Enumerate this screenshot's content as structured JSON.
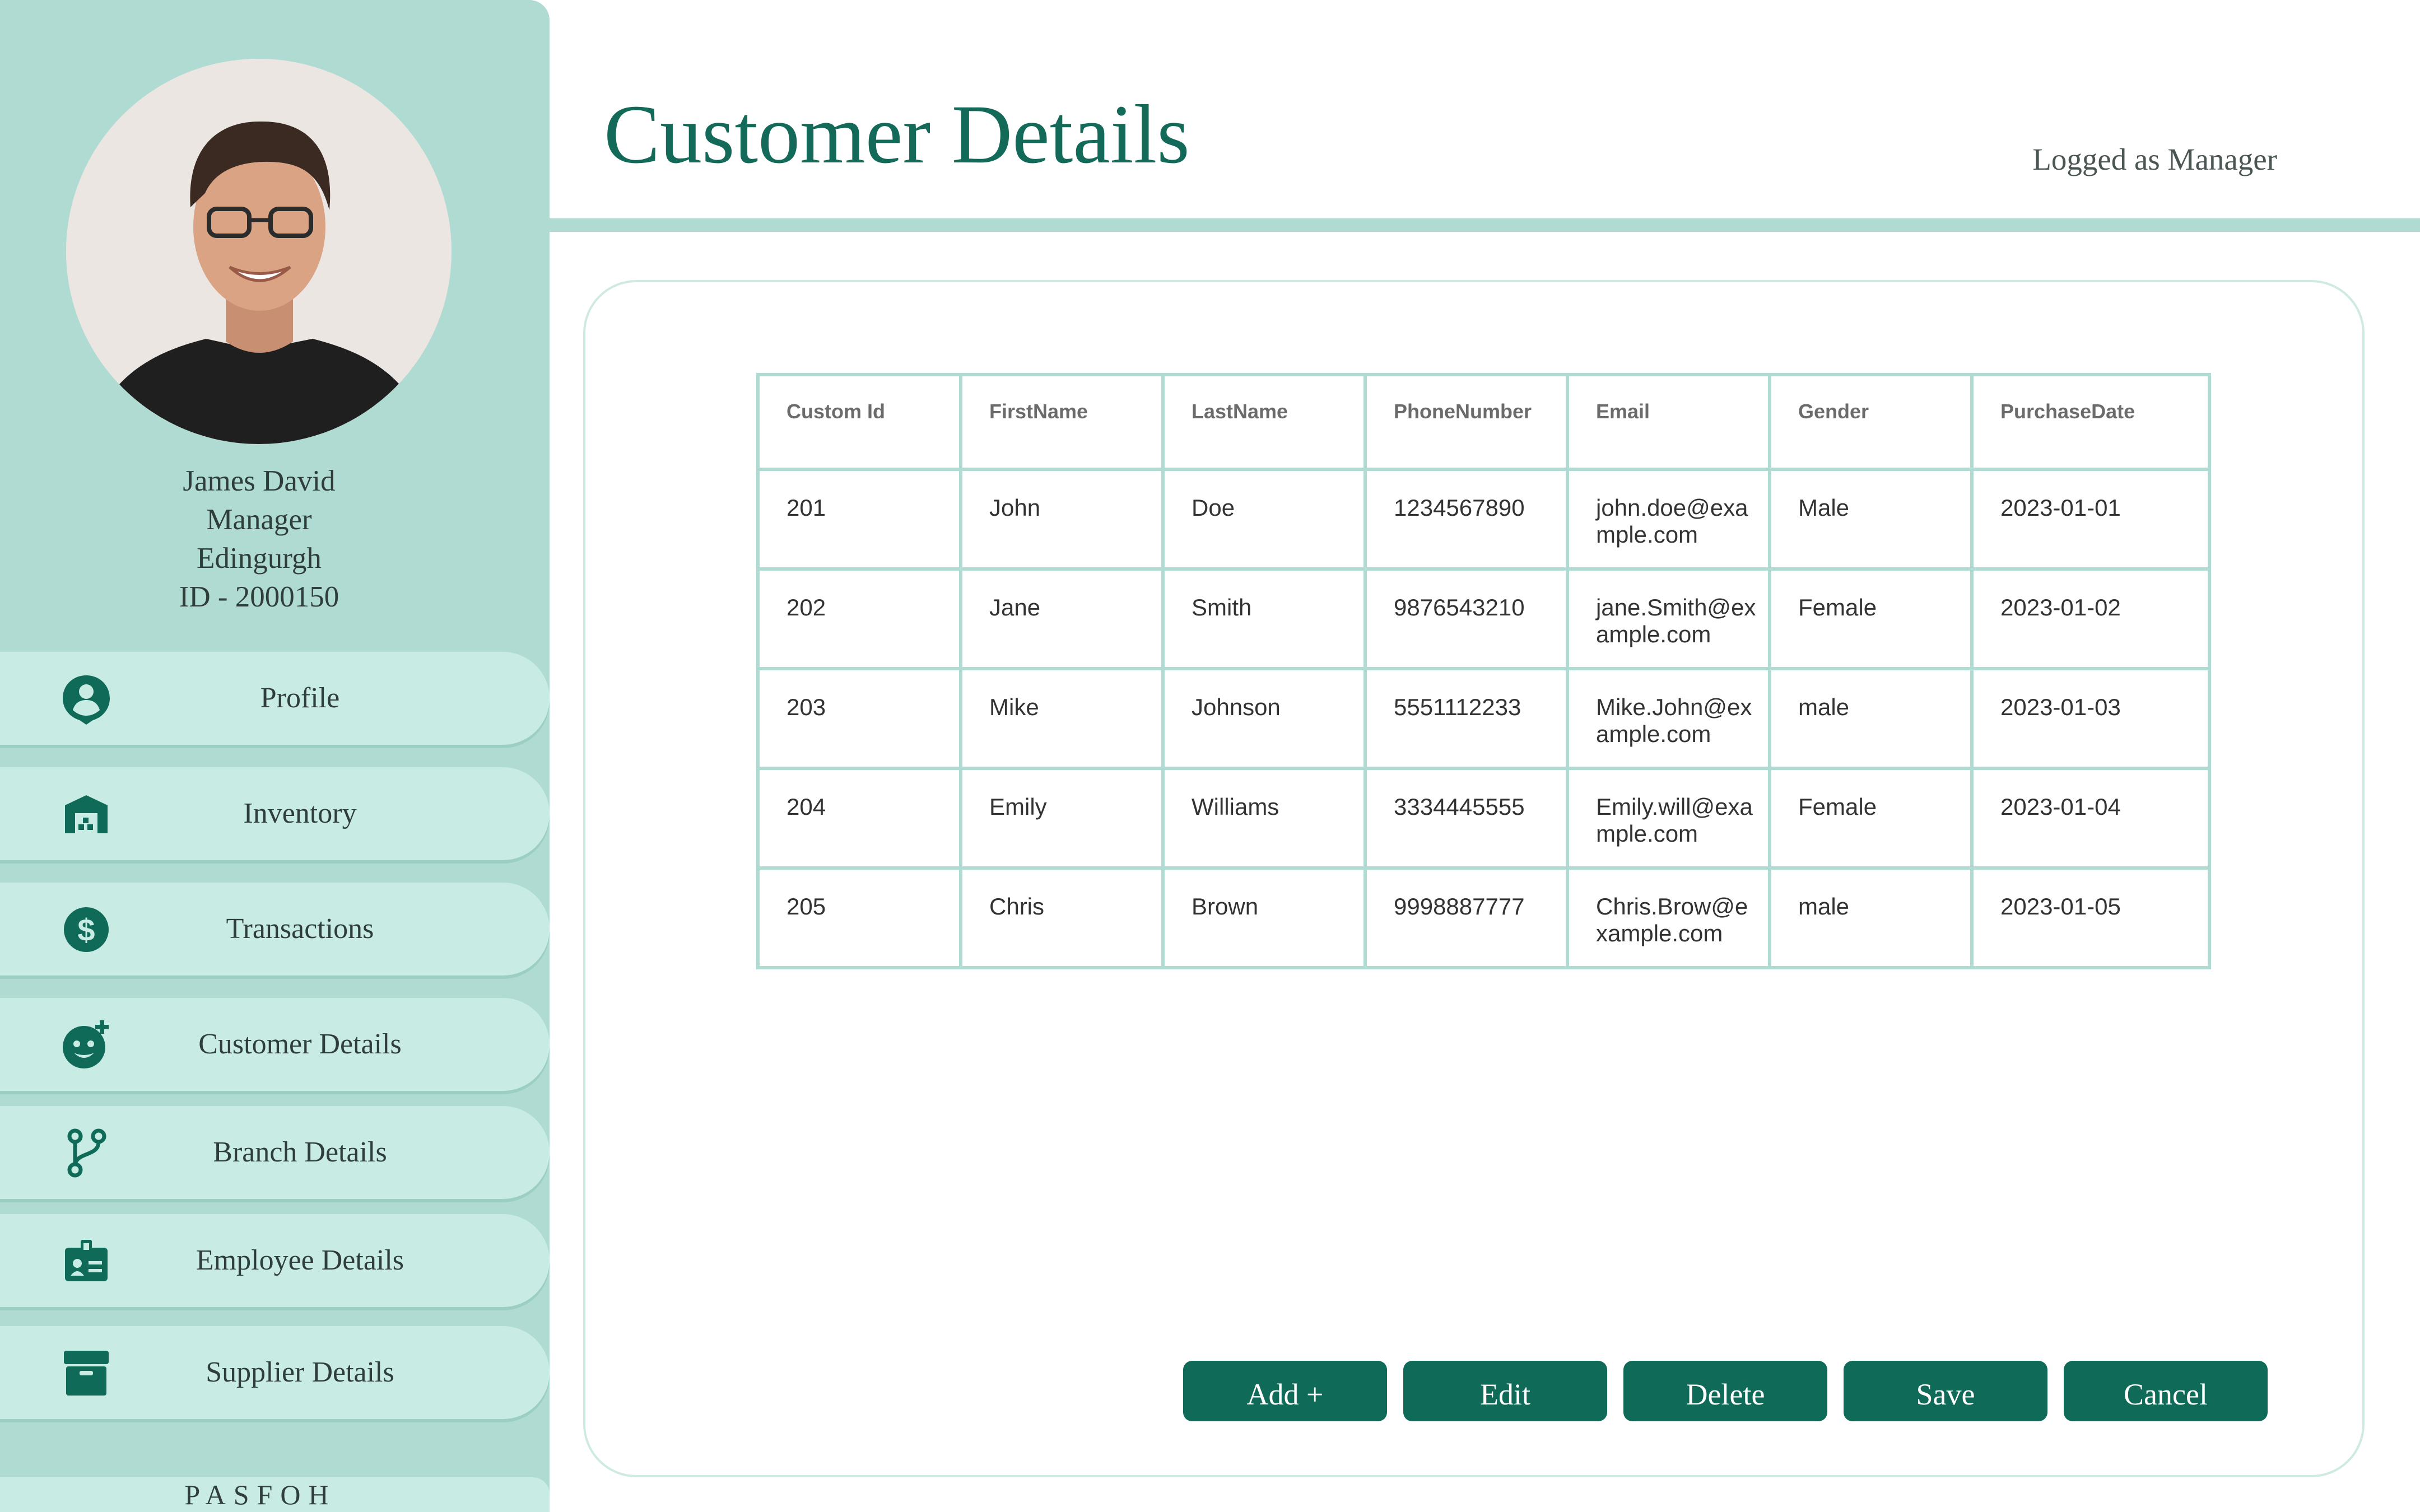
{
  "page": {
    "title": "Customer Details",
    "logged_as": "Logged as Manager"
  },
  "user": {
    "name": "James David",
    "role": "Manager",
    "location": "Edingurgh",
    "id": "ID - 2000150"
  },
  "sidebar": {
    "items": [
      {
        "label": "Profile",
        "icon": "profile-icon"
      },
      {
        "label": "Inventory",
        "icon": "warehouse-icon"
      },
      {
        "label": "Transactions",
        "icon": "dollar-icon"
      },
      {
        "label": "Customer Details",
        "icon": "add-face-icon"
      },
      {
        "label": "Branch Details",
        "icon": "branch-icon"
      },
      {
        "label": "Employee Details",
        "icon": "id-badge-icon"
      },
      {
        "label": "Supplier Details",
        "icon": "archive-icon"
      }
    ],
    "brand": "PASFOH"
  },
  "table": {
    "headers": [
      "Custom Id",
      "FirstName",
      "LastName",
      "PhoneNumber",
      "Email",
      "Gender",
      "PurchaseDate"
    ],
    "rows": [
      [
        "201",
        "John",
        "Doe",
        "1234567890",
        "john.doe@example.com",
        "Male",
        "2023-01-01"
      ],
      [
        "202",
        "Jane",
        "Smith",
        "9876543210",
        "jane.Smith@example.com",
        "Female",
        "2023-01-02"
      ],
      [
        "203",
        "Mike",
        "Johnson",
        "5551112233",
        "Mike.John@example.com",
        "male",
        "2023-01-03"
      ],
      [
        "204",
        "Emily",
        "Williams",
        "3334445555",
        "Emily.will@example.com",
        "Female",
        "2023-01-04"
      ],
      [
        "205",
        "Chris",
        "Brown",
        "9998887777",
        "Chris.Brow@example.com",
        "male",
        "2023-01-05"
      ]
    ]
  },
  "actions": {
    "add": "Add +",
    "edit": "Edit",
    "delete": "Delete",
    "save": "Save",
    "cancel": "Cancel"
  },
  "colors": {
    "sidebar_bg": "#afdbd2",
    "nav_item_bg": "#c8ebe4",
    "accent": "#146a58",
    "button_bg": "#0f6b58",
    "table_border": "#afdbd2"
  }
}
